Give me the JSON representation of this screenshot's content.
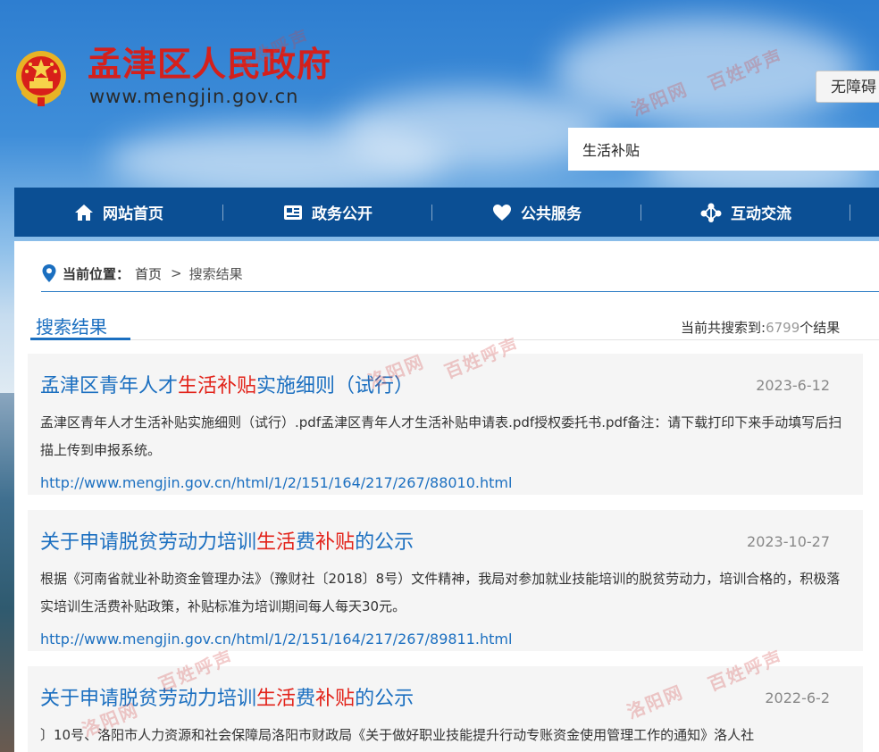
{
  "header": {
    "site_title": "孟津区人民政府",
    "site_url": "www.mengjin.gov.cn",
    "a11y_button": "无障碍",
    "search_value": "生活补贴"
  },
  "nav": {
    "items": [
      {
        "label": "网站首页",
        "icon": "home-icon"
      },
      {
        "label": "政务公开",
        "icon": "document-icon"
      },
      {
        "label": "公共服务",
        "icon": "heart-icon"
      },
      {
        "label": "互动交流",
        "icon": "network-icon"
      }
    ]
  },
  "breadcrumb": {
    "label": "当前位置：",
    "home": "首页",
    "separator": ">",
    "current": "搜索结果"
  },
  "results_header": {
    "tab_label": "搜索结果",
    "count_prefix": "当前共搜索到:",
    "count_value": "6799",
    "count_suffix": "个结果"
  },
  "results": [
    {
      "title_parts": {
        "p1": "孟津区青年人才",
        "h1": "生活补贴",
        "p2": "实施细则（试行）",
        "h2": "",
        "p3": "",
        "h3": "",
        "p4": ""
      },
      "date": "2023-6-12",
      "desc": "孟津区青年人才生活补贴实施细则（试行）.pdf孟津区青年人才生活补贴申请表.pdf授权委托书.pdf备注：请下载打印下来手动填写后扫描上传到申报系统。",
      "url": "http://www.mengjin.gov.cn/html/1/2/151/164/217/267/88010.html"
    },
    {
      "title_parts": {
        "p1": "关于申请脱贫劳动力培训",
        "h1": "生活",
        "p2": "费",
        "h2": "补贴",
        "p3": "的公示",
        "h3": "",
        "p4": ""
      },
      "date": "2023-10-27",
      "desc": "根据《河南省就业补助资金管理办法》（豫财社〔2018〕8号）文件精神，我局对参加就业技能培训的脱贫劳动力，培训合格的，积极落实培训生活费补贴政策，补贴标准为培训期间每人每天30元。",
      "url": "http://www.mengjin.gov.cn/html/1/2/151/164/217/267/89811.html"
    },
    {
      "title_parts": {
        "p1": "关于申请脱贫劳动力培训",
        "h1": "生活",
        "p2": "费",
        "h2": "补贴",
        "p3": "的公示",
        "h3": "",
        "p4": ""
      },
      "date": "2022-6-2",
      "desc": "〕10号、洛阳市人力资源和社会保障局洛阳市财政局《关于做好职业技能提升行动专账资金使用管理工作的通知》洛人社",
      "url": ""
    }
  ],
  "watermarks": [
    "洛阳网",
    "百姓呼声"
  ],
  "colors": {
    "nav_bg": "#0b4f94",
    "title_red": "#d4201c",
    "link_blue": "#1b6fc0",
    "highlight_red": "#e2231a"
  }
}
